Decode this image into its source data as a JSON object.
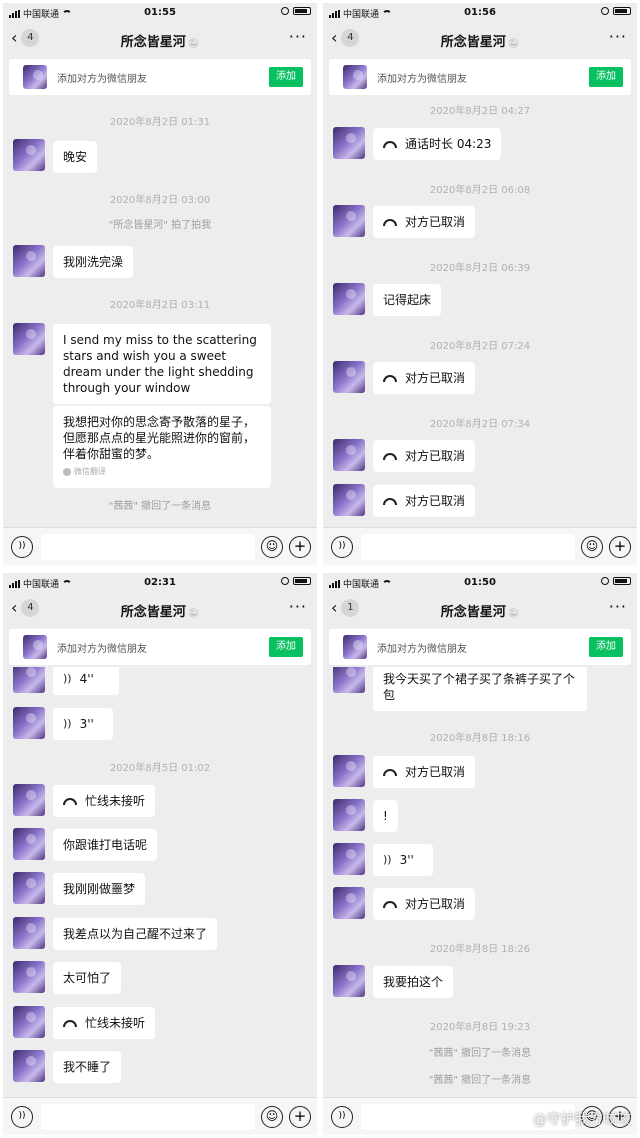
{
  "panels": [
    {
      "status": {
        "carrier": "中国联通",
        "time": "01:55"
      },
      "nav": {
        "back_count": "4",
        "title": "所念皆星河"
      },
      "add_friend": {
        "text": "添加对方为微信朋友",
        "button": "添加"
      },
      "messages": {
        "ts1": "2020年8月2日 01:31",
        "m1": "晚安",
        "ts2": "2020年8月2日 03:00",
        "sys1": "\"所念皆星河\" 拍了拍我",
        "m2": "我刚洗完澡",
        "ts3": "2020年8月2日 03:11",
        "m3": "I send my miss to the scattering stars and wish you a sweet dream under the light shedding through your window",
        "m4": "我想把对你的思念寄予散落的星子，但愿那点点的星光能照进你的窗前，伴着你甜蜜的梦。",
        "m4_note": "微信翻译",
        "sys2": "\"茜茜\" 撤回了一条消息"
      }
    },
    {
      "status": {
        "carrier": "中国联通",
        "time": "01:56"
      },
      "nav": {
        "back_count": "4",
        "title": "所念皆星河"
      },
      "add_friend": {
        "text": "添加对方为微信朋友",
        "button": "添加"
      },
      "messages": {
        "ts1": "2020年8月2日 04:27",
        "m1": "通话时长 04:23",
        "ts2": "2020年8月2日 06:08",
        "m2": "对方已取消",
        "ts3": "2020年8月2日 06:39",
        "m3": "记得起床",
        "ts4": "2020年8月2日 07:24",
        "m4": "对方已取消",
        "ts5": "2020年8月2日 07:34",
        "m5": "对方已取消",
        "m6": "对方已取消"
      }
    },
    {
      "status": {
        "carrier": "中国联通",
        "time": "02:31"
      },
      "nav": {
        "back_count": "4",
        "title": "所念皆星河"
      },
      "add_friend": {
        "text": "添加对方为微信朋友",
        "button": "添加"
      },
      "messages": {
        "v1": "4''",
        "v2": "3''",
        "ts1": "2020年8月5日 01:02",
        "m1": "忙线未接听",
        "m2": "你跟谁打电话呢",
        "m3": "我刚刚做噩梦",
        "m4": "我差点以为自己醒不过来了",
        "m5": "太可怕了",
        "m6": "忙线未接听",
        "m7": "我不睡了"
      }
    },
    {
      "status": {
        "carrier": "中国联通",
        "time": "01:50"
      },
      "nav": {
        "back_count": "1",
        "title": "所念皆星河"
      },
      "add_friend": {
        "text": "添加对方为微信朋友",
        "button": "添加"
      },
      "messages": {
        "m1": "我今天买了个裙子买了条裤子买了个包",
        "ts1": "2020年8月8日 18:16",
        "m2": "对方已取消",
        "m3": "!",
        "v1": "3''",
        "m4": "对方已取消",
        "ts2": "2020年8月8日 18:26",
        "m5": "我要拍这个",
        "ts3": "2020年8月8日 19:23",
        "sys1": "\"茜茜\" 撤回了一条消息",
        "sys2": "\"茜茜\" 撤回了一条消息"
      }
    }
  ],
  "watermark": "@守护我方咬咬",
  "colors": {
    "panel_bg": "#ededed",
    "accent_green": "#07c160",
    "bubble": "#ffffff"
  }
}
